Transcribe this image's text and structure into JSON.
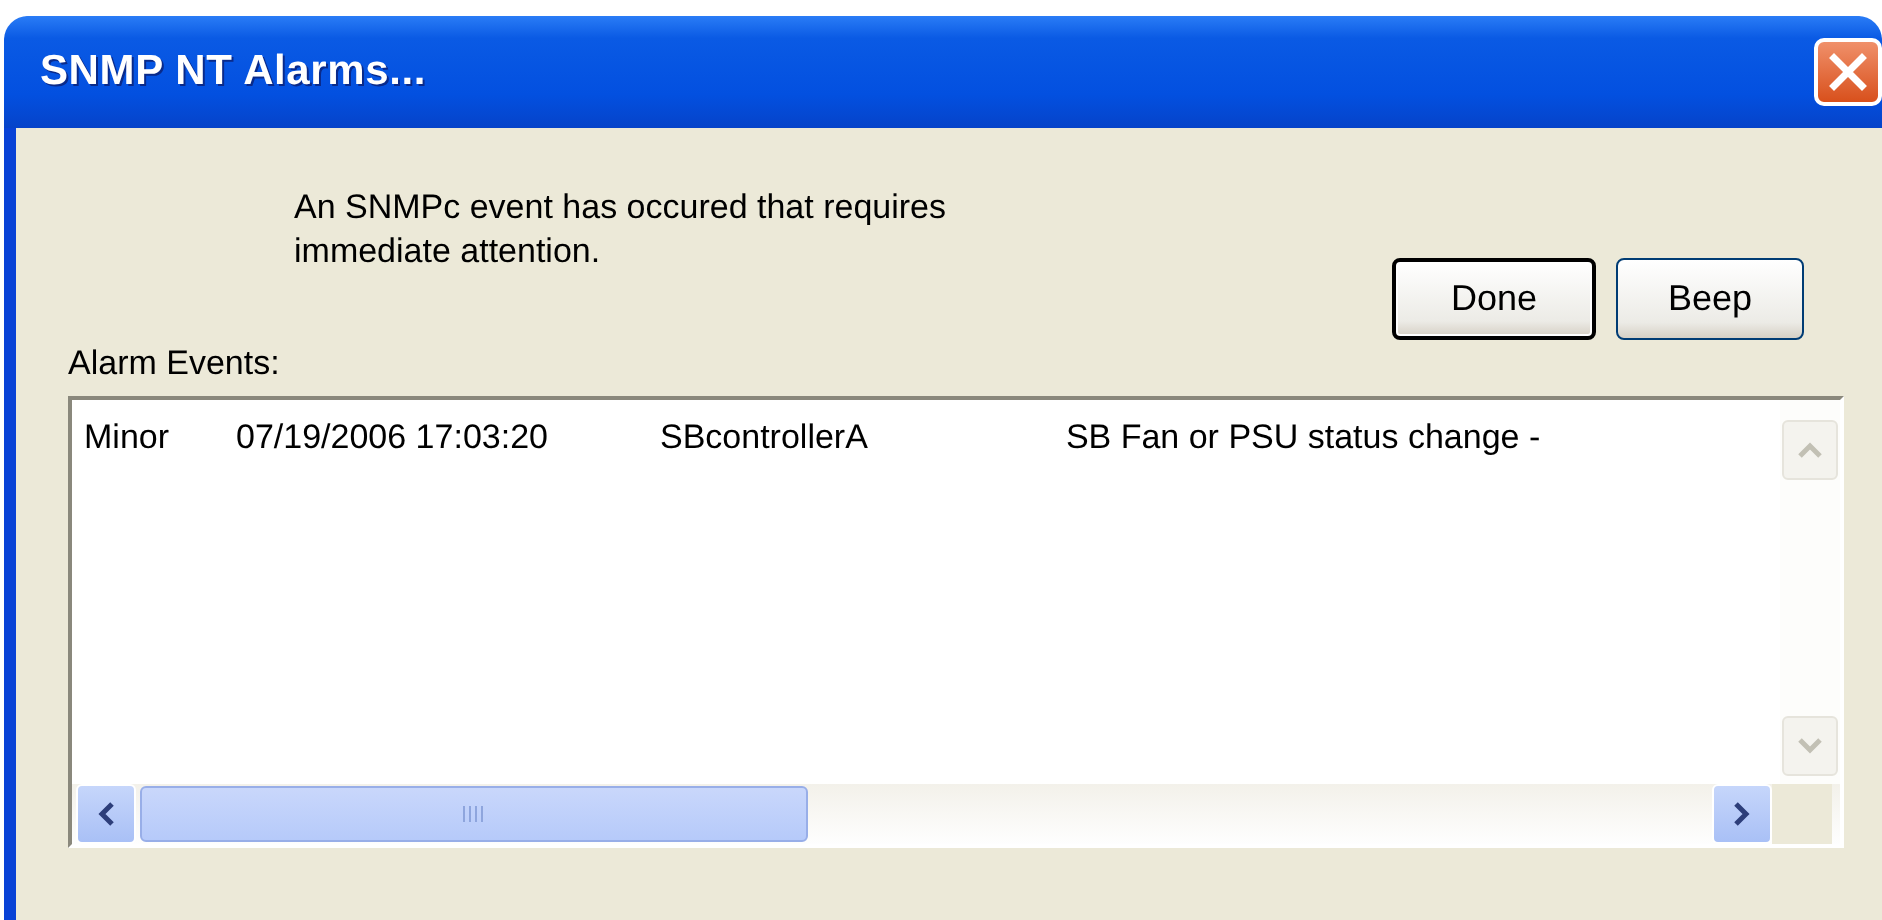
{
  "window": {
    "title": "SNMP NT Alarms..."
  },
  "message": "An SNMPc event has occured that requires immediate attention.",
  "buttons": [
    {
      "label": "Done",
      "default": true
    },
    {
      "label": "Beep",
      "default": false
    }
  ],
  "list_label": "Alarm Events:",
  "events": [
    {
      "column_1": "Minor",
      "column_2": "07/19/2006 17:03:20",
      "column_3": "SBcontrollerA",
      "column_4": "SB Fan or PSU status change -"
    }
  ]
}
